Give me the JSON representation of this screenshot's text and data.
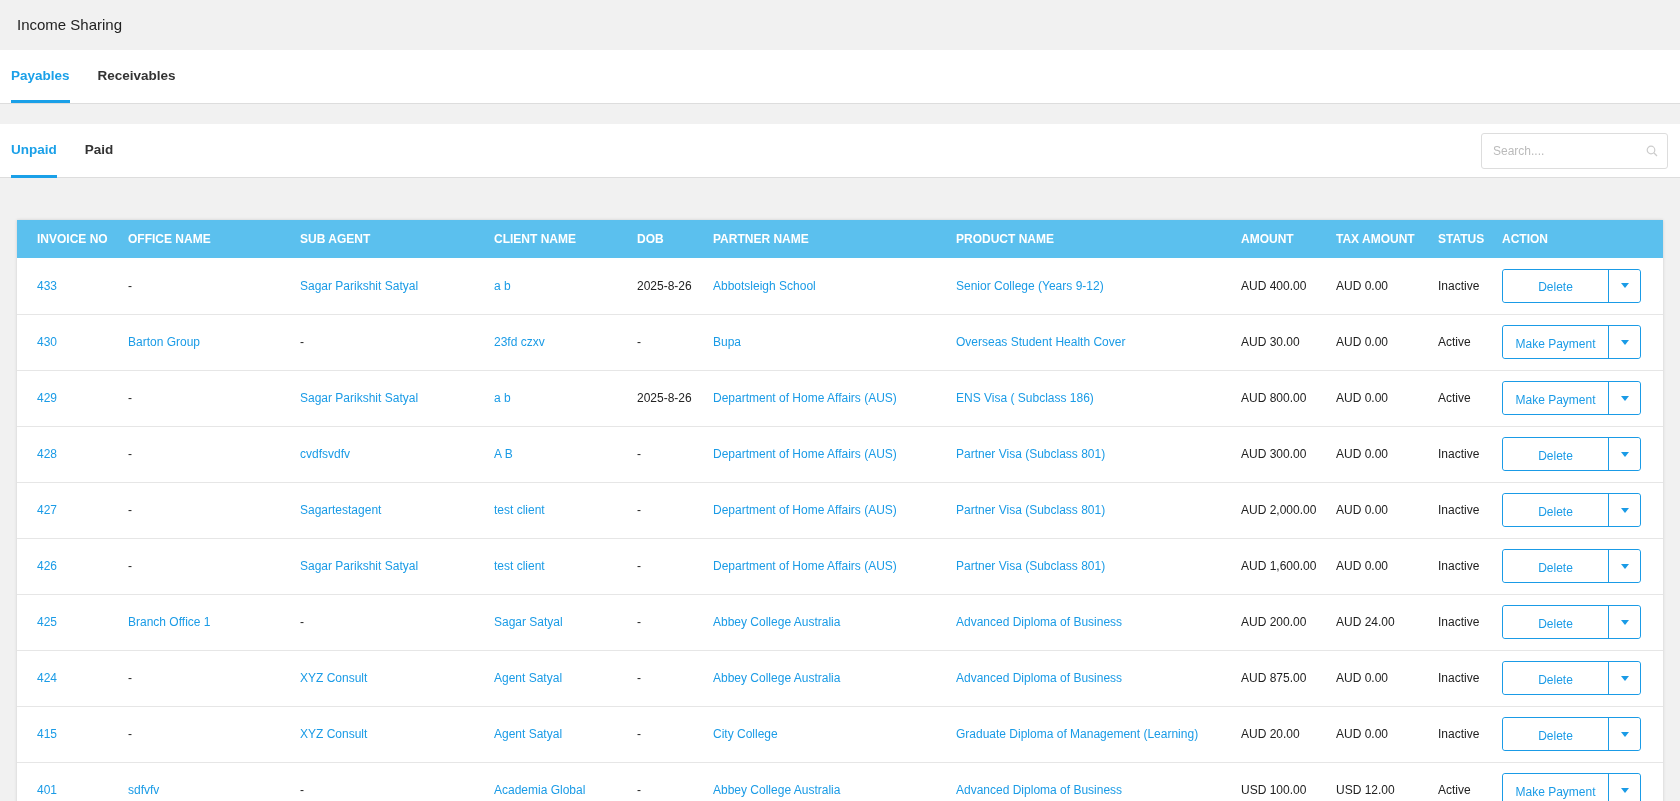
{
  "page": {
    "title": "Income Sharing"
  },
  "tabs": [
    {
      "label": "Payables",
      "selected": true
    },
    {
      "label": "Receivables",
      "selected": false
    }
  ],
  "subtabs": [
    {
      "label": "Unpaid",
      "selected": true
    },
    {
      "label": "Paid",
      "selected": false
    }
  ],
  "search": {
    "placeholder": "Search...."
  },
  "table": {
    "columns": [
      "INVOICE NO",
      "OFFICE NAME",
      "SUB AGENT",
      "CLIENT NAME",
      "DOB",
      "PARTNER NAME",
      "PRODUCT NAME",
      "AMOUNT",
      "TAX AMOUNT",
      "STATUS",
      "ACTION"
    ],
    "rows": [
      {
        "cells": [
          {
            "text": "433",
            "link": true
          },
          {
            "text": "-",
            "link": false
          },
          {
            "text": "Sagar Parikshit Satyal",
            "link": true
          },
          {
            "text": "a b",
            "link": true
          },
          {
            "text": "2025-8-26",
            "link": false
          },
          {
            "text": "Abbotsleigh School",
            "link": true
          },
          {
            "text": "Senior College (Years 9-12)",
            "link": true
          },
          {
            "text": "AUD 400.00",
            "link": false
          },
          {
            "text": "AUD 0.00",
            "link": false
          },
          {
            "text": "Inactive",
            "link": false
          }
        ],
        "action": "Delete"
      },
      {
        "cells": [
          {
            "text": "430",
            "link": true
          },
          {
            "text": "Barton Group",
            "link": true
          },
          {
            "text": "-",
            "link": false
          },
          {
            "text": "23fd czxv",
            "link": true
          },
          {
            "text": "-",
            "link": false
          },
          {
            "text": "Bupa",
            "link": true
          },
          {
            "text": "Overseas Student Health Cover",
            "link": true
          },
          {
            "text": "AUD 30.00",
            "link": false
          },
          {
            "text": "AUD 0.00",
            "link": false
          },
          {
            "text": "Active",
            "link": false
          }
        ],
        "action": "Make Payment"
      },
      {
        "cells": [
          {
            "text": "429",
            "link": true
          },
          {
            "text": "-",
            "link": false
          },
          {
            "text": "Sagar Parikshit Satyal",
            "link": true
          },
          {
            "text": "a b",
            "link": true
          },
          {
            "text": "2025-8-26",
            "link": false
          },
          {
            "text": "Department of Home Affairs (AUS)",
            "link": true
          },
          {
            "text": "ENS Visa ( Subclass 186)",
            "link": true
          },
          {
            "text": "AUD 800.00",
            "link": false
          },
          {
            "text": "AUD 0.00",
            "link": false
          },
          {
            "text": "Active",
            "link": false
          }
        ],
        "action": "Make Payment"
      },
      {
        "cells": [
          {
            "text": "428",
            "link": true
          },
          {
            "text": "-",
            "link": false
          },
          {
            "text": "cvdfsvdfv",
            "link": true
          },
          {
            "text": "A B",
            "link": true
          },
          {
            "text": "-",
            "link": false
          },
          {
            "text": "Department of Home Affairs (AUS)",
            "link": true
          },
          {
            "text": "Partner Visa (Subclass 801)",
            "link": true
          },
          {
            "text": "AUD 300.00",
            "link": false
          },
          {
            "text": "AUD 0.00",
            "link": false
          },
          {
            "text": "Inactive",
            "link": false
          }
        ],
        "action": "Delete"
      },
      {
        "cells": [
          {
            "text": "427",
            "link": true
          },
          {
            "text": "-",
            "link": false
          },
          {
            "text": "Sagartestagent",
            "link": true
          },
          {
            "text": "test client",
            "link": true
          },
          {
            "text": "-",
            "link": false
          },
          {
            "text": "Department of Home Affairs (AUS)",
            "link": true
          },
          {
            "text": "Partner Visa (Subclass 801)",
            "link": true
          },
          {
            "text": "AUD 2,000.00",
            "link": false
          },
          {
            "text": "AUD 0.00",
            "link": false
          },
          {
            "text": "Inactive",
            "link": false
          }
        ],
        "action": "Delete"
      },
      {
        "cells": [
          {
            "text": "426",
            "link": true
          },
          {
            "text": "-",
            "link": false
          },
          {
            "text": "Sagar Parikshit Satyal",
            "link": true
          },
          {
            "text": "test client",
            "link": true
          },
          {
            "text": "-",
            "link": false
          },
          {
            "text": "Department of Home Affairs (AUS)",
            "link": true
          },
          {
            "text": "Partner Visa (Subclass 801)",
            "link": true
          },
          {
            "text": "AUD 1,600.00",
            "link": false
          },
          {
            "text": "AUD 0.00",
            "link": false
          },
          {
            "text": "Inactive",
            "link": false
          }
        ],
        "action": "Delete"
      },
      {
        "cells": [
          {
            "text": "425",
            "link": true
          },
          {
            "text": "Branch Office 1",
            "link": true
          },
          {
            "text": "-",
            "link": false
          },
          {
            "text": "Sagar Satyal",
            "link": true
          },
          {
            "text": "-",
            "link": false
          },
          {
            "text": "Abbey College Australia",
            "link": true
          },
          {
            "text": "Advanced Diploma of Business",
            "link": true
          },
          {
            "text": "AUD 200.00",
            "link": false
          },
          {
            "text": "AUD 24.00",
            "link": false
          },
          {
            "text": "Inactive",
            "link": false
          }
        ],
        "action": "Delete"
      },
      {
        "cells": [
          {
            "text": "424",
            "link": true
          },
          {
            "text": "-",
            "link": false
          },
          {
            "text": "XYZ Consult",
            "link": true
          },
          {
            "text": "Agent Satyal",
            "link": true
          },
          {
            "text": "-",
            "link": false
          },
          {
            "text": "Abbey College Australia",
            "link": true
          },
          {
            "text": "Advanced Diploma of Business",
            "link": true
          },
          {
            "text": "AUD 875.00",
            "link": false
          },
          {
            "text": "AUD 0.00",
            "link": false
          },
          {
            "text": "Inactive",
            "link": false
          }
        ],
        "action": "Delete"
      },
      {
        "cells": [
          {
            "text": "415",
            "link": true
          },
          {
            "text": "-",
            "link": false
          },
          {
            "text": "XYZ Consult",
            "link": true
          },
          {
            "text": "Agent Satyal",
            "link": true
          },
          {
            "text": "-",
            "link": false
          },
          {
            "text": "City College",
            "link": true
          },
          {
            "text": "Graduate Diploma of Management (Learning)",
            "link": true
          },
          {
            "text": "AUD 20.00",
            "link": false
          },
          {
            "text": "AUD 0.00",
            "link": false
          },
          {
            "text": "Inactive",
            "link": false
          }
        ],
        "action": "Delete"
      },
      {
        "cells": [
          {
            "text": "401",
            "link": true
          },
          {
            "text": "sdfvfv",
            "link": true
          },
          {
            "text": "-",
            "link": false
          },
          {
            "text": "Academia Global",
            "link": true
          },
          {
            "text": "-",
            "link": false
          },
          {
            "text": "Abbey College Australia",
            "link": true
          },
          {
            "text": "Advanced Diploma of Business",
            "link": true
          },
          {
            "text": "USD 100.00",
            "link": false
          },
          {
            "text": "USD 12.00",
            "link": false
          },
          {
            "text": "Active",
            "link": false
          }
        ],
        "action": "Make Payment"
      }
    ]
  }
}
